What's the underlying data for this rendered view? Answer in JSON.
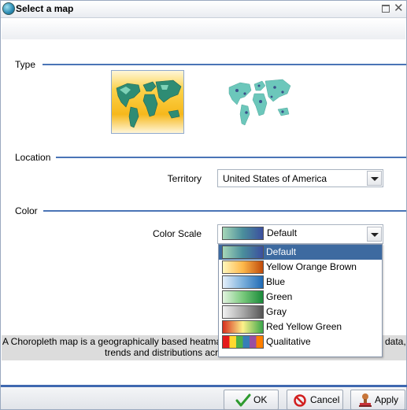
{
  "window": {
    "title": "Select a map"
  },
  "sections": {
    "type": "Type",
    "location": "Location",
    "color": "Color"
  },
  "location": {
    "territory_label": "Territory",
    "territory_value": "United States of America"
  },
  "color": {
    "scale_label": "Color Scale",
    "scale_value": "Default",
    "options": [
      {
        "label": "Default",
        "selected": true,
        "colors": [
          "#a6d7b8",
          "#4a8e9c",
          "#3b4f9e"
        ]
      },
      {
        "label": "Yellow Orange Brown",
        "selected": false,
        "colors": [
          "#fff7bc",
          "#fdb84a",
          "#c04a0a"
        ]
      },
      {
        "label": "Blue",
        "selected": false,
        "colors": [
          "#e6f0fa",
          "#7bb0dc",
          "#1f6ab5"
        ]
      },
      {
        "label": "Green",
        "selected": false,
        "colors": [
          "#e3f4e0",
          "#79c97c",
          "#1a8a3a"
        ]
      },
      {
        "label": "Gray",
        "selected": false,
        "colors": [
          "#f2f2f2",
          "#a8a8a8",
          "#555555"
        ]
      },
      {
        "label": "Red Yellow Green",
        "selected": false,
        "colors": [
          "#d7301f",
          "#fdf28a",
          "#3aa64a"
        ]
      },
      {
        "label": "Qualitative",
        "selected": false,
        "colors": [
          "#e41a1c",
          "#ffd92f",
          "#4daf4a",
          "#377eb8",
          "#984ea3",
          "#ff7f00"
        ]
      }
    ]
  },
  "description": {
    "line1_left": "A Choropleth map is a geographically based heatmap",
    "line1_right": "data,",
    "line2": "trends and distributions acro"
  },
  "buttons": {
    "ok": "OK",
    "cancel": "Cancel",
    "apply": "Apply"
  },
  "accent_color": "#4a74b6",
  "selection_color": "#3d6aa0"
}
